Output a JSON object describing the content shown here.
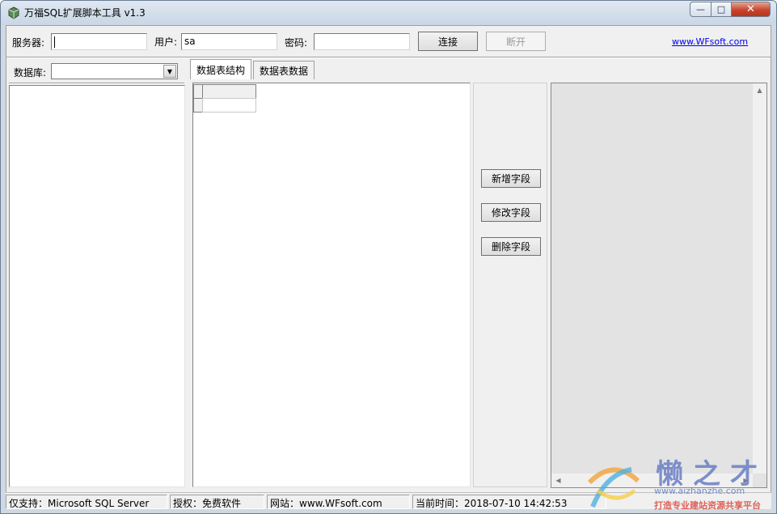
{
  "window": {
    "title": "万福SQL扩展脚本工具 v1.3",
    "minimize_glyph": "—",
    "maximize_glyph": "□",
    "close_glyph": "✕"
  },
  "connection": {
    "server_label": "服务器:",
    "server_value": "",
    "user_label": "用户:",
    "user_value": "sa",
    "password_label": "密码:",
    "password_value": "",
    "connect_button": "连接",
    "disconnect_button": "断开",
    "site_link": "www.WFsoft.com"
  },
  "database": {
    "label": "数据库:",
    "selected": ""
  },
  "tabs": [
    {
      "label": "数据表结构",
      "active": true
    },
    {
      "label": "数据表数据",
      "active": false
    }
  ],
  "field_buttons": {
    "add": "新增字段",
    "edit": "修改字段",
    "delete": "删除字段"
  },
  "statusbar": {
    "support": "仅支持：Microsoft SQL Server",
    "license": "授权：免费软件",
    "website": "网站：www.WFsoft.com",
    "time": "当前时间：2018-07-10 14:42:53"
  },
  "watermark": {
    "title": "懒之才",
    "url": "www.aizhanzhe.com",
    "tagline": "打造专业建站资源共享平台"
  },
  "colors": {
    "client_bg": "#f0f0f0",
    "link": "#0000ee",
    "close_button": "#c7452d"
  }
}
